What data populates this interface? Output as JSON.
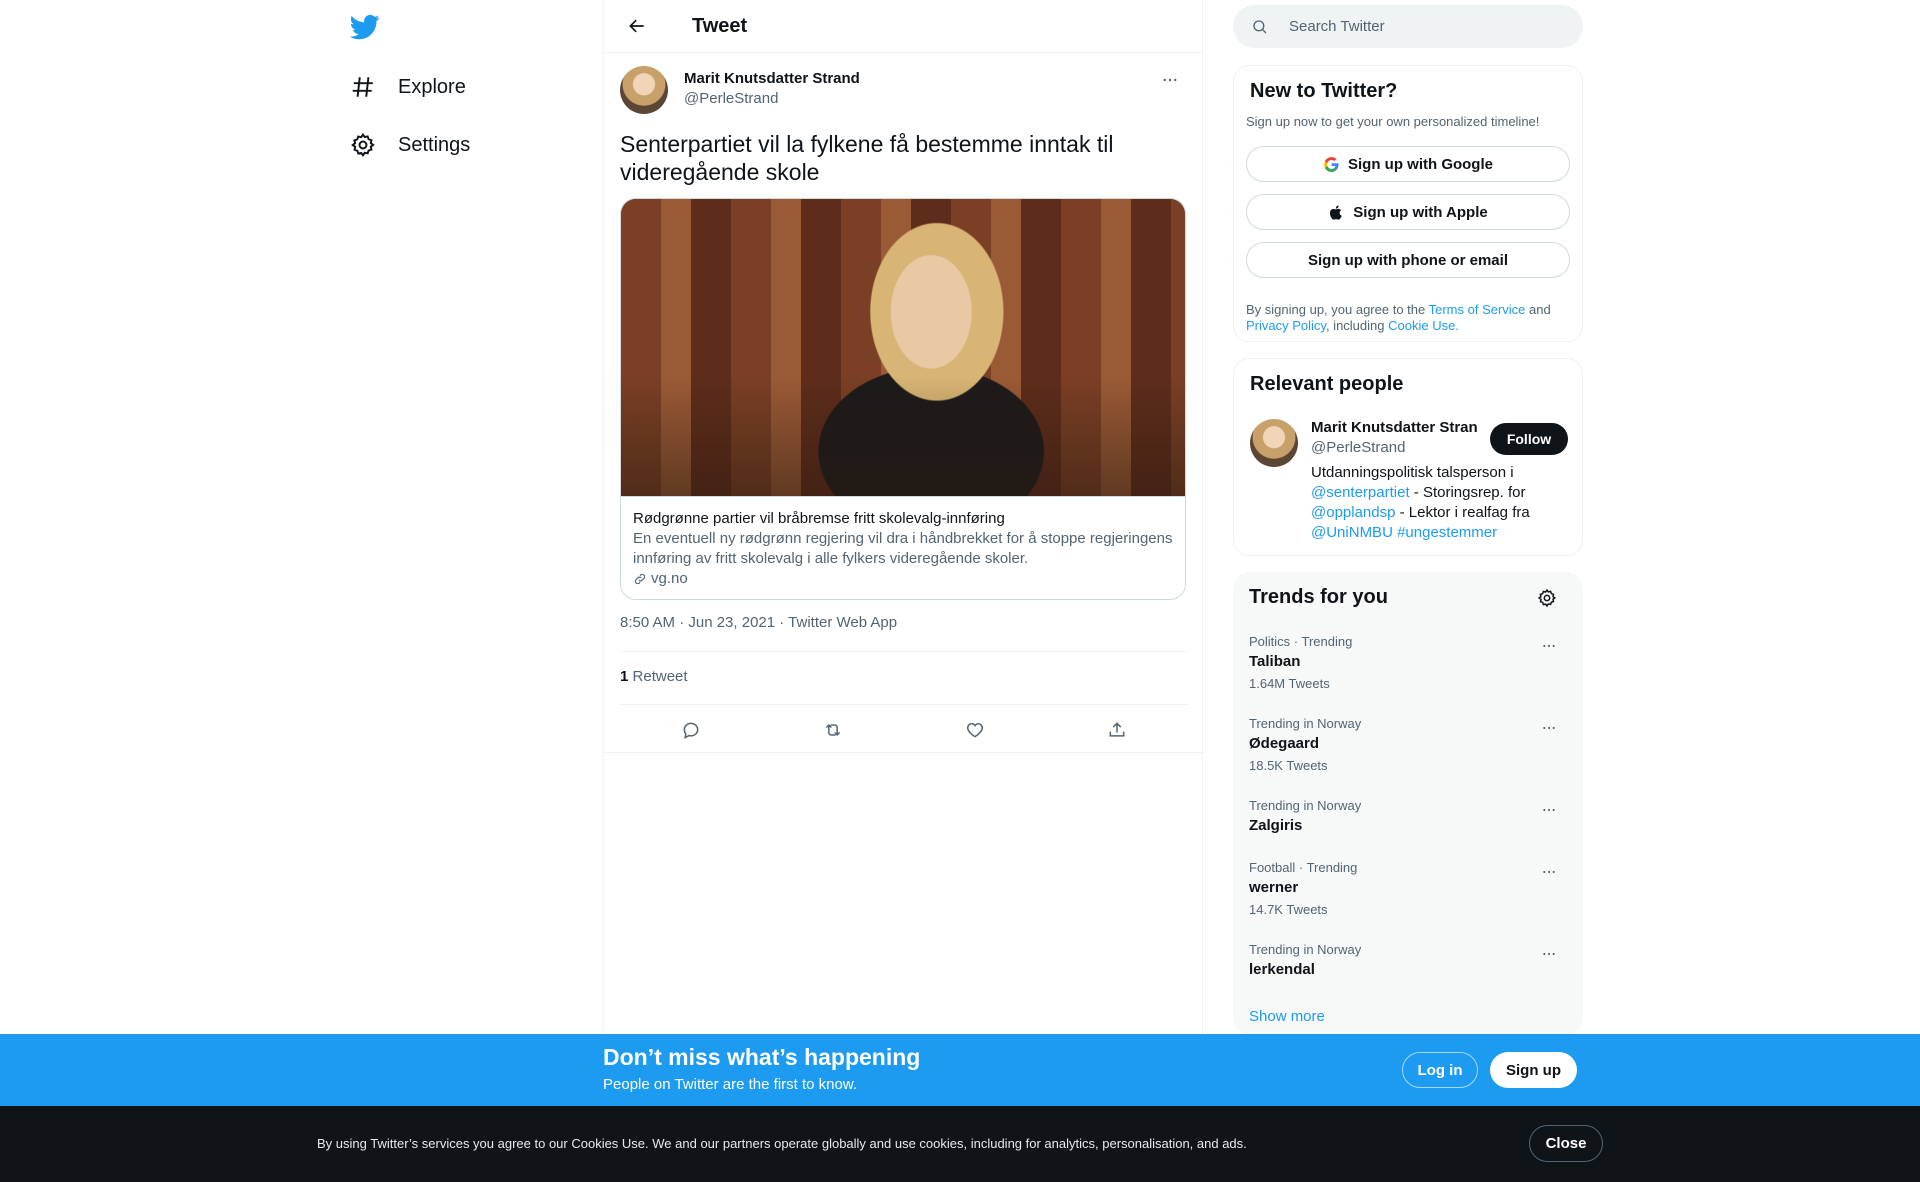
{
  "colors": {
    "accent": "#1d9bf0",
    "text": "#0f1419",
    "muted": "#536471",
    "cookie_bg": "#0f1419"
  },
  "nav": {
    "logo_icon": "twitter-bird-icon",
    "items": [
      {
        "label": "Explore",
        "icon": "hashtag-icon"
      },
      {
        "label": "Settings",
        "icon": "gear-icon"
      }
    ]
  },
  "header": {
    "title": "Tweet",
    "back_icon": "arrow-left-icon"
  },
  "tweet": {
    "author_name": "Marit Knutsdatter Strand",
    "author_handle": "@PerleStrand",
    "text": "Senterpartiet vil la fylkene få bestemme inntak til videregående skole",
    "card": {
      "title": "Rødgrønne partier vil bråbremse fritt skolevalg-innføring",
      "description": "En eventuell ny rødgrønn regjering vil dra i håndbrekket for å stoppe regjeringens innføring av fritt skolevalg i alle fylkers videregående skoler.",
      "domain": "vg.no"
    },
    "timestamp": "8:50 AM · Jun 23, 2021 · Twitter Web App",
    "retweet_count": "1",
    "retweet_label": "Retweet"
  },
  "search": {
    "placeholder": "Search Twitter"
  },
  "signup_panel": {
    "title": "New to Twitter?",
    "subtitle": "Sign up now to get your own personalized timeline!",
    "google_label": "Sign up with Google",
    "apple_label": "Sign up with Apple",
    "phone_label": "Sign up with phone or email",
    "legal_1": "By signing up, you agree to the ",
    "terms": "Terms of Service",
    "legal_2": " and ",
    "privacy": "Privacy Policy",
    "legal_3": ", including ",
    "cookie": "Cookie Use."
  },
  "relevant": {
    "title": "Relevant people",
    "name": "Marit Knutsdatter Strand",
    "handle": "@PerleStrand",
    "follow_label": "Follow",
    "bio_1": "Utdanningspolitisk talsperson i ",
    "bio_link_1": "@senterpartiet",
    "bio_2": " - Storingsrep. for ",
    "bio_link_2": "@opplandsp",
    "bio_3": " - Lektor i realfag fra ",
    "bio_link_3": "@UniNMBU",
    "bio_link_4": "#ungestemmer"
  },
  "trends": {
    "title": "Trends for you",
    "items": [
      {
        "context": "Politics · Trending",
        "name": "Taliban",
        "count": "1.64M Tweets"
      },
      {
        "context": "Trending in Norway",
        "name": "Ødegaard",
        "count": "18.5K Tweets"
      },
      {
        "context": "Trending in Norway",
        "name": "Zalgiris",
        "count": ""
      },
      {
        "context": "Football · Trending",
        "name": "werner",
        "count": "14.7K Tweets"
      },
      {
        "context": "Trending in Norway",
        "name": "lerkendal",
        "count": ""
      }
    ],
    "show_more": "Show more"
  },
  "banner": {
    "title": "Don’t miss what’s happening",
    "subtitle": "People on Twitter are the first to know.",
    "login_label": "Log in",
    "signup_label": "Sign up"
  },
  "cookie_bar": {
    "text": "By using Twitter’s services you agree to our Cookies Use. We and our partners operate globally and use cookies, including for analytics, personalisation, and ads.",
    "close_label": "Close"
  }
}
